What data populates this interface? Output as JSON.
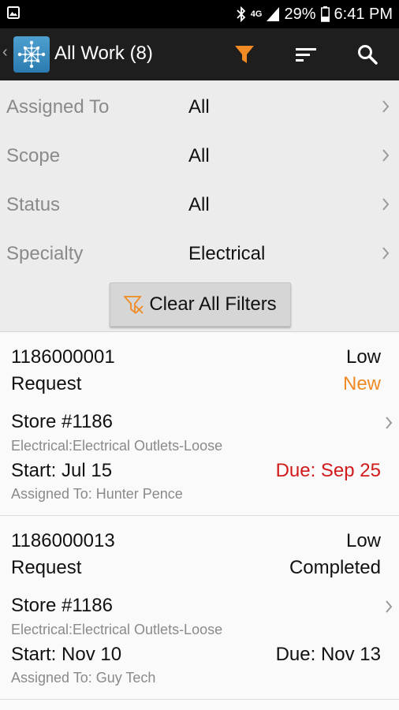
{
  "status_bar": {
    "battery": "29%",
    "time": "6:41 PM",
    "network": "4G"
  },
  "action_bar": {
    "back_icon": "chevron-left-icon",
    "title": "All Work (8)",
    "filter_icon_color": "#f08a24"
  },
  "filters": [
    {
      "label": "Assigned To",
      "value": "All"
    },
    {
      "label": "Scope",
      "value": "All"
    },
    {
      "label": "Status",
      "value": "All"
    },
    {
      "label": "Specialty",
      "value": "Electrical"
    }
  ],
  "clear_button": {
    "label": "Clear All Filters"
  },
  "work_items": [
    {
      "number": "1186000001",
      "priority": "Low",
      "type": "Request",
      "status": "New",
      "status_color": "#f08a24",
      "location": "Store #1186",
      "category": "Electrical:Electrical Outlets-Loose",
      "start": "Start: Jul 15",
      "due": "Due: Sep 25",
      "due_color": "#d11a1a",
      "assigned": "Assigned To: Hunter Pence"
    },
    {
      "number": "1186000013",
      "priority": "Low",
      "type": "Request",
      "status": "Completed",
      "status_color": "#111111",
      "location": "Store #1186",
      "category": "Electrical:Electrical Outlets-Loose",
      "start": "Start: Nov 10",
      "due": "Due: Nov 13",
      "due_color": "#111111",
      "assigned": "Assigned To: Guy Tech"
    }
  ]
}
